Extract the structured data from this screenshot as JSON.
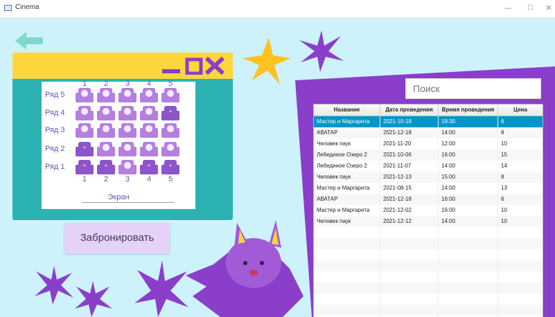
{
  "window": {
    "title": "Cinema",
    "minimize": "—",
    "maximize": "☐",
    "close": "✕"
  },
  "seatmap": {
    "columns": [
      "1",
      "2",
      "3",
      "4",
      "5"
    ],
    "rows": [
      {
        "label": "Ряд 5",
        "seats": [
          "free",
          "free",
          "free",
          "free",
          "free"
        ]
      },
      {
        "label": "Ряд 4",
        "seats": [
          "free",
          "free",
          "free",
          "free",
          "taken"
        ]
      },
      {
        "label": "Ряд 3",
        "seats": [
          "free",
          "free",
          "free",
          "free",
          "free"
        ]
      },
      {
        "label": "Ряд 2",
        "seats": [
          "taken",
          "free",
          "free",
          "free",
          "free"
        ]
      },
      {
        "label": "Ряд 1",
        "seats": [
          "taken",
          "taken",
          "free",
          "taken",
          "taken"
        ]
      }
    ],
    "screen_label": "Экран"
  },
  "book_button": "Забронировать",
  "search": {
    "placeholder": "Поиск"
  },
  "table": {
    "headers": [
      "Название",
      "Дата проведения",
      "Время проведения",
      "Цена"
    ],
    "selected_index": 0,
    "rows": [
      [
        "Мастер и Маргарита",
        "2021-10-18",
        "19:30",
        "6"
      ],
      [
        "АВАТАР",
        "2021-12-18",
        "14:00",
        "8"
      ],
      [
        "Человек паук",
        "2021-11-20",
        "12:00",
        "10"
      ],
      [
        "Лебединое Озеро 2",
        "2021-10-06",
        "16:00",
        "15"
      ],
      [
        "Лебединое Озеро 2",
        "2021-11-07",
        "14:00",
        "14"
      ],
      [
        "Человек паук",
        "2021-12-13",
        "15:00",
        "8"
      ],
      [
        "Мастер и Маргарита",
        "2021-08-15",
        "14:00",
        "13"
      ],
      [
        "АВАТАР",
        "2021-12-18",
        "16:00",
        "6"
      ],
      [
        "Мастер и Маргарита",
        "2021-12-02",
        "16:00",
        "10"
      ],
      [
        "Человек паук",
        "2021-12-12",
        "14:00",
        "10"
      ]
    ],
    "empty_rows": 9
  },
  "colors": {
    "background": "#cdf2fc",
    "accent": "#0096c9",
    "panel": "#2db2b4",
    "panel_top": "#ffd53c",
    "purple": "#8a3ec9",
    "seat_free": "#b57fe0",
    "seat_taken": "#8c55c8"
  }
}
